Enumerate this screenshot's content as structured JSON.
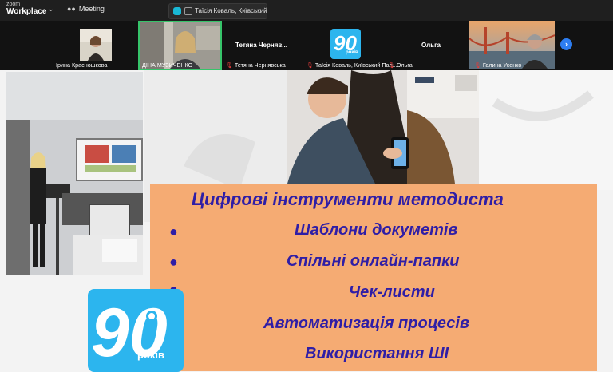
{
  "app": {
    "brand_small": "zoom",
    "brand_big": "Workplace",
    "meeting_label": "Meeting"
  },
  "share_tab": {
    "label": "Таїсія Коваль, Київський Па"
  },
  "participants": [
    {
      "name": "Ірина Красношкова",
      "muted": false
    },
    {
      "name": "ДІНА МУЗИЧЕНКО",
      "muted": false
    },
    {
      "name": "Тетяна Чернявська",
      "muted": true,
      "header": "Тетяна  Черняв..."
    },
    {
      "name": "Таїсія Коваль, Київський Пал...",
      "muted": true,
      "logo_text": "років"
    },
    {
      "name": "Ольга",
      "muted": true,
      "header": "Ольга"
    },
    {
      "name": "Галина Усенко",
      "muted": true
    }
  ],
  "slide": {
    "title": "Цифрові інструменти методиста",
    "items": [
      "Шаблони докуметів",
      "Спільні онлайн-папки",
      "Чек-листи",
      "Автоматизація процесів",
      "Використання ШІ"
    ],
    "logo_text": "років",
    "colors": {
      "card": "#f5ab73",
      "text": "#2f1ea6",
      "logo": "#2cb5ee"
    }
  }
}
